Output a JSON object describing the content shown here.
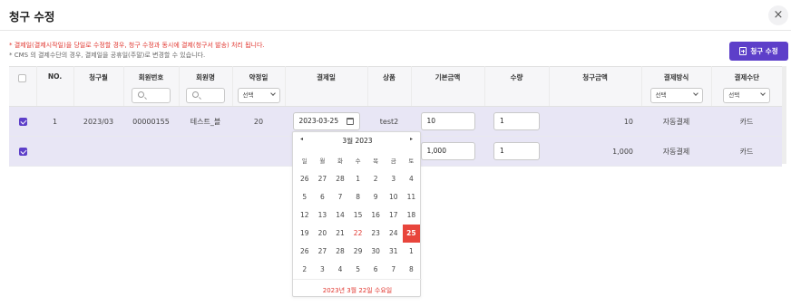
{
  "modal": {
    "title": "청구 수정",
    "close_symbol": "×",
    "notice_1": "* 결제일(결제시작일)을 당일로 수정할 경우, 청구 수정과 동시에 결제(청구서 발송) 처리 됩니다.",
    "notice_2": "* CMS 의 결제수단의 경우, 결제일을 공휴일(주말)로 변경할 수 있습니다.",
    "submit_label": "청구 수정"
  },
  "table": {
    "headers": {
      "no": "NO.",
      "month": "청구월",
      "member_no": "회원번호",
      "member_name": "회원명",
      "agreed_day": "약정일",
      "pay_date": "결제일",
      "product": "상품",
      "base_amount": "기본금액",
      "qty": "수량",
      "bill_amount": "청구금액",
      "pay_method": "결제방식",
      "pay_type": "결제수단"
    },
    "filters": {
      "agreed_day_select": "선택",
      "pay_method_select": "선택",
      "pay_type_select": "선택"
    },
    "rows": [
      {
        "checked": true,
        "no": "1",
        "month": "2023/03",
        "member_no": "00000155",
        "member_name": "테스트_블",
        "agreed_day": "20",
        "pay_date": "2023-03-25",
        "product": "test2",
        "base_amount": "10",
        "qty": "1",
        "bill_amount": "10",
        "pay_method": "자동결제",
        "pay_type": "카드"
      },
      {
        "checked": true,
        "no": "",
        "month": "",
        "member_no": "",
        "member_name": "",
        "agreed_day": "",
        "pay_date": "",
        "product": "",
        "base_amount": "1,000",
        "qty": "1",
        "bill_amount": "1,000",
        "pay_method": "자동결제",
        "pay_type": "카드"
      }
    ]
  },
  "datepicker": {
    "prev": "◂",
    "next": "▸",
    "month_label": "3월 2023",
    "weekdays": [
      "일",
      "월",
      "화",
      "수",
      "목",
      "금",
      "토"
    ],
    "days": [
      "26",
      "27",
      "28",
      "1",
      "2",
      "3",
      "4",
      "5",
      "6",
      "7",
      "8",
      "9",
      "10",
      "11",
      "12",
      "13",
      "14",
      "15",
      "16",
      "17",
      "18",
      "19",
      "20",
      "21",
      "22",
      "23",
      "24",
      "25",
      "26",
      "27",
      "28",
      "29",
      "30",
      "31",
      "1",
      "2",
      "3",
      "4",
      "5",
      "6",
      "7",
      "8"
    ],
    "holiday_day": "22",
    "selected_day": "25",
    "footer": "2023년 3월 22일 수요일"
  },
  "colors": {
    "accent": "#5d3fc9",
    "row_selected": "#e8e6f5",
    "warn": "#e1362f"
  }
}
